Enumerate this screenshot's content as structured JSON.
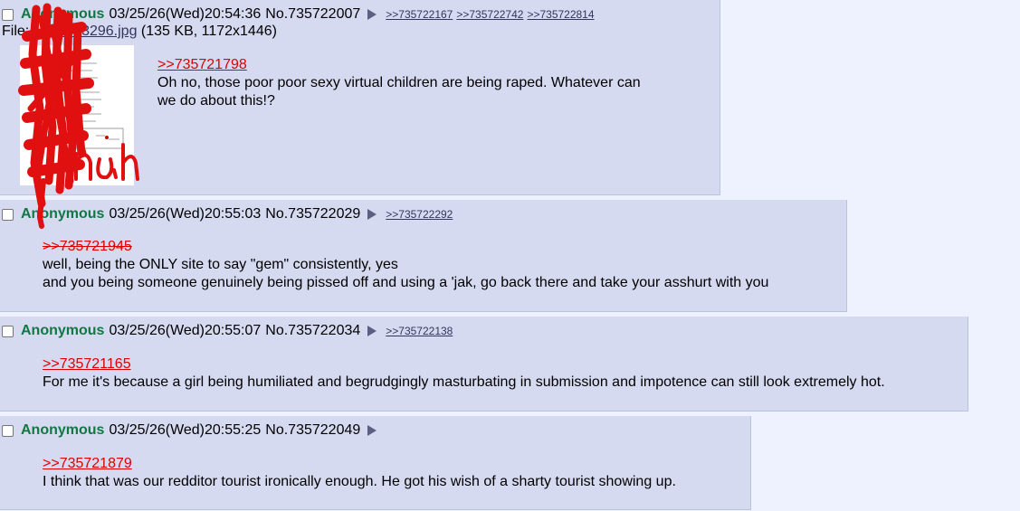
{
  "colors": {
    "page_bg": "#eef2ff",
    "reply_bg": "#d6daf0",
    "name": "#117743",
    "quote": "#dd0000",
    "link": "#34345c",
    "scribble": "#e01010"
  },
  "posts": [
    {
      "name": "Anonymous",
      "datetime": "03/25/26(Wed)20:54:36",
      "number": "No.735722007",
      "backlinks": [
        ">>735722167",
        ">>735722742",
        ">>735722814"
      ],
      "file": {
        "prefix": "File:",
        "filename": "1068063296.jpg",
        "details": "(135 KB, 1172x1446)"
      },
      "quote": ">>735721798",
      "lines": [
        "Oh no, those poor poor sexy virtual children are being raped. Whatever can",
        "we do about this!?"
      ]
    },
    {
      "name": "Anonymous",
      "datetime": "03/25/26(Wed)20:55:03",
      "number": "No.735722029",
      "backlinks": [
        ">>735722292"
      ],
      "quote": ">>735721945",
      "lines": [
        "well, being the ONLY site to say \"gem\" consistently, yes",
        "and you being someone genuinely being pissed off and using a 'jak, go back there and take your asshurt with you"
      ]
    },
    {
      "name": "Anonymous",
      "datetime": "03/25/26(Wed)20:55:07",
      "number": "No.735722034",
      "backlinks": [
        ">>735722138"
      ],
      "quote": ">>735721165",
      "lines": [
        "For me it's because a girl being humiliated and begrudgingly masturbating in submission and impotence can still look extremely hot."
      ]
    },
    {
      "name": "Anonymous",
      "datetime": "03/25/26(Wed)20:55:25",
      "number": "No.735722049",
      "backlinks": [],
      "quote": ">>735721879",
      "lines": [
        "I think that was our redditor tourist ironically enough. He got his wish of a sharty tourist showing up."
      ]
    }
  ]
}
